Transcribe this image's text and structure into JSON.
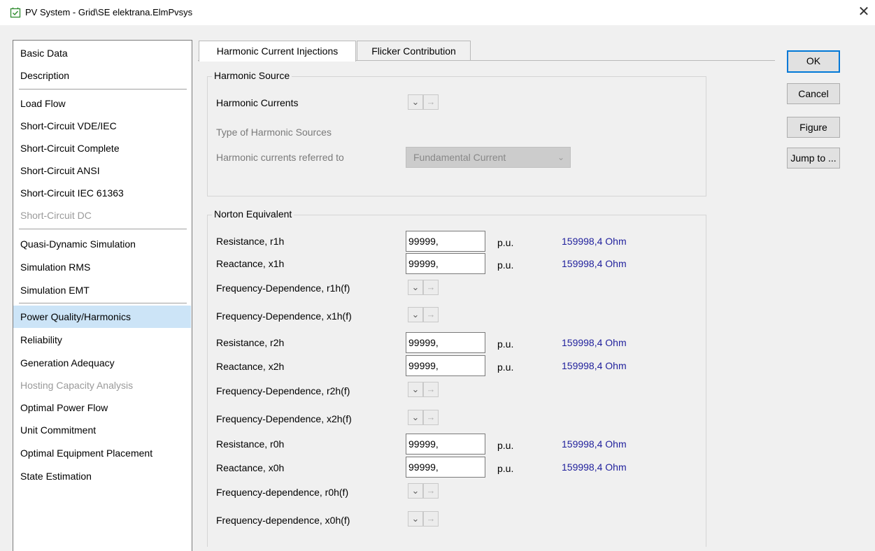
{
  "window": {
    "title": "PV System - Grid\\SE elektrana.ElmPvsys",
    "close_glyph": "✕"
  },
  "nav": {
    "items": [
      {
        "label": "Basic Data"
      },
      {
        "label": "Description"
      },
      {
        "label": "Load Flow"
      },
      {
        "label": "Short-Circuit VDE/IEC"
      },
      {
        "label": "Short-Circuit Complete"
      },
      {
        "label": "Short-Circuit ANSI"
      },
      {
        "label": "Short-Circuit IEC 61363"
      },
      {
        "label": "Short-Circuit DC",
        "disabled": true
      },
      {
        "label": "Quasi-Dynamic Simulation"
      },
      {
        "label": "Simulation RMS"
      },
      {
        "label": "Simulation EMT"
      },
      {
        "label": "Power Quality/Harmonics",
        "selected": true
      },
      {
        "label": "Reliability"
      },
      {
        "label": "Generation Adequacy"
      },
      {
        "label": "Hosting Capacity Analysis",
        "disabled": true
      },
      {
        "label": "Optimal Power Flow"
      },
      {
        "label": "Unit Commitment"
      },
      {
        "label": "Optimal Equipment Placement"
      },
      {
        "label": "State Estimation"
      }
    ]
  },
  "tabs": [
    {
      "label": "Harmonic Current Injections",
      "active": true
    },
    {
      "label": "Flicker Contribution",
      "active": false
    }
  ],
  "harmonic_source": {
    "legend": "Harmonic Source",
    "harmonic_currents_label": "Harmonic Currents",
    "type_label": "Type of Harmonic Sources",
    "referred_label": "Harmonic currents referred to",
    "referred_value": "Fundamental Current"
  },
  "norton": {
    "legend": "Norton Equivalent",
    "rows": [
      {
        "label": "Resistance, r1h",
        "value": "99999,",
        "unit": "p.u.",
        "calc": "159998,4 Ohm"
      },
      {
        "label": "Reactance, x1h",
        "value": "99999,",
        "unit": "p.u.",
        "calc": "159998,4 Ohm"
      },
      {
        "label": "Frequency-Dependence, r1h(f)"
      },
      {
        "label": "Frequency-Dependence, x1h(f)"
      },
      {
        "label": "Resistance, r2h",
        "value": "99999,",
        "unit": "p.u.",
        "calc": "159998,4 Ohm"
      },
      {
        "label": "Reactance, x2h",
        "value": "99999,",
        "unit": "p.u.",
        "calc": "159998,4 Ohm"
      },
      {
        "label": "Frequency-Dependence, r2h(f)"
      },
      {
        "label": "Frequency-Dependence, x2h(f)"
      },
      {
        "label": "Resistance, r0h",
        "value": "99999,",
        "unit": "p.u.",
        "calc": "159998,4 Ohm"
      },
      {
        "label": "Reactance, x0h",
        "value": "99999,",
        "unit": "p.u.",
        "calc": "159998,4 Ohm"
      },
      {
        "label": "Frequency-dependence, r0h(f)"
      },
      {
        "label": "Frequency-dependence, x0h(f)"
      }
    ]
  },
  "mini_buttons": {
    "dropdown_glyph": "⌄",
    "arrow_glyph": "→"
  },
  "buttons": {
    "ok": "OK",
    "cancel": "Cancel",
    "figure": "Figure",
    "jump": "Jump to ..."
  }
}
